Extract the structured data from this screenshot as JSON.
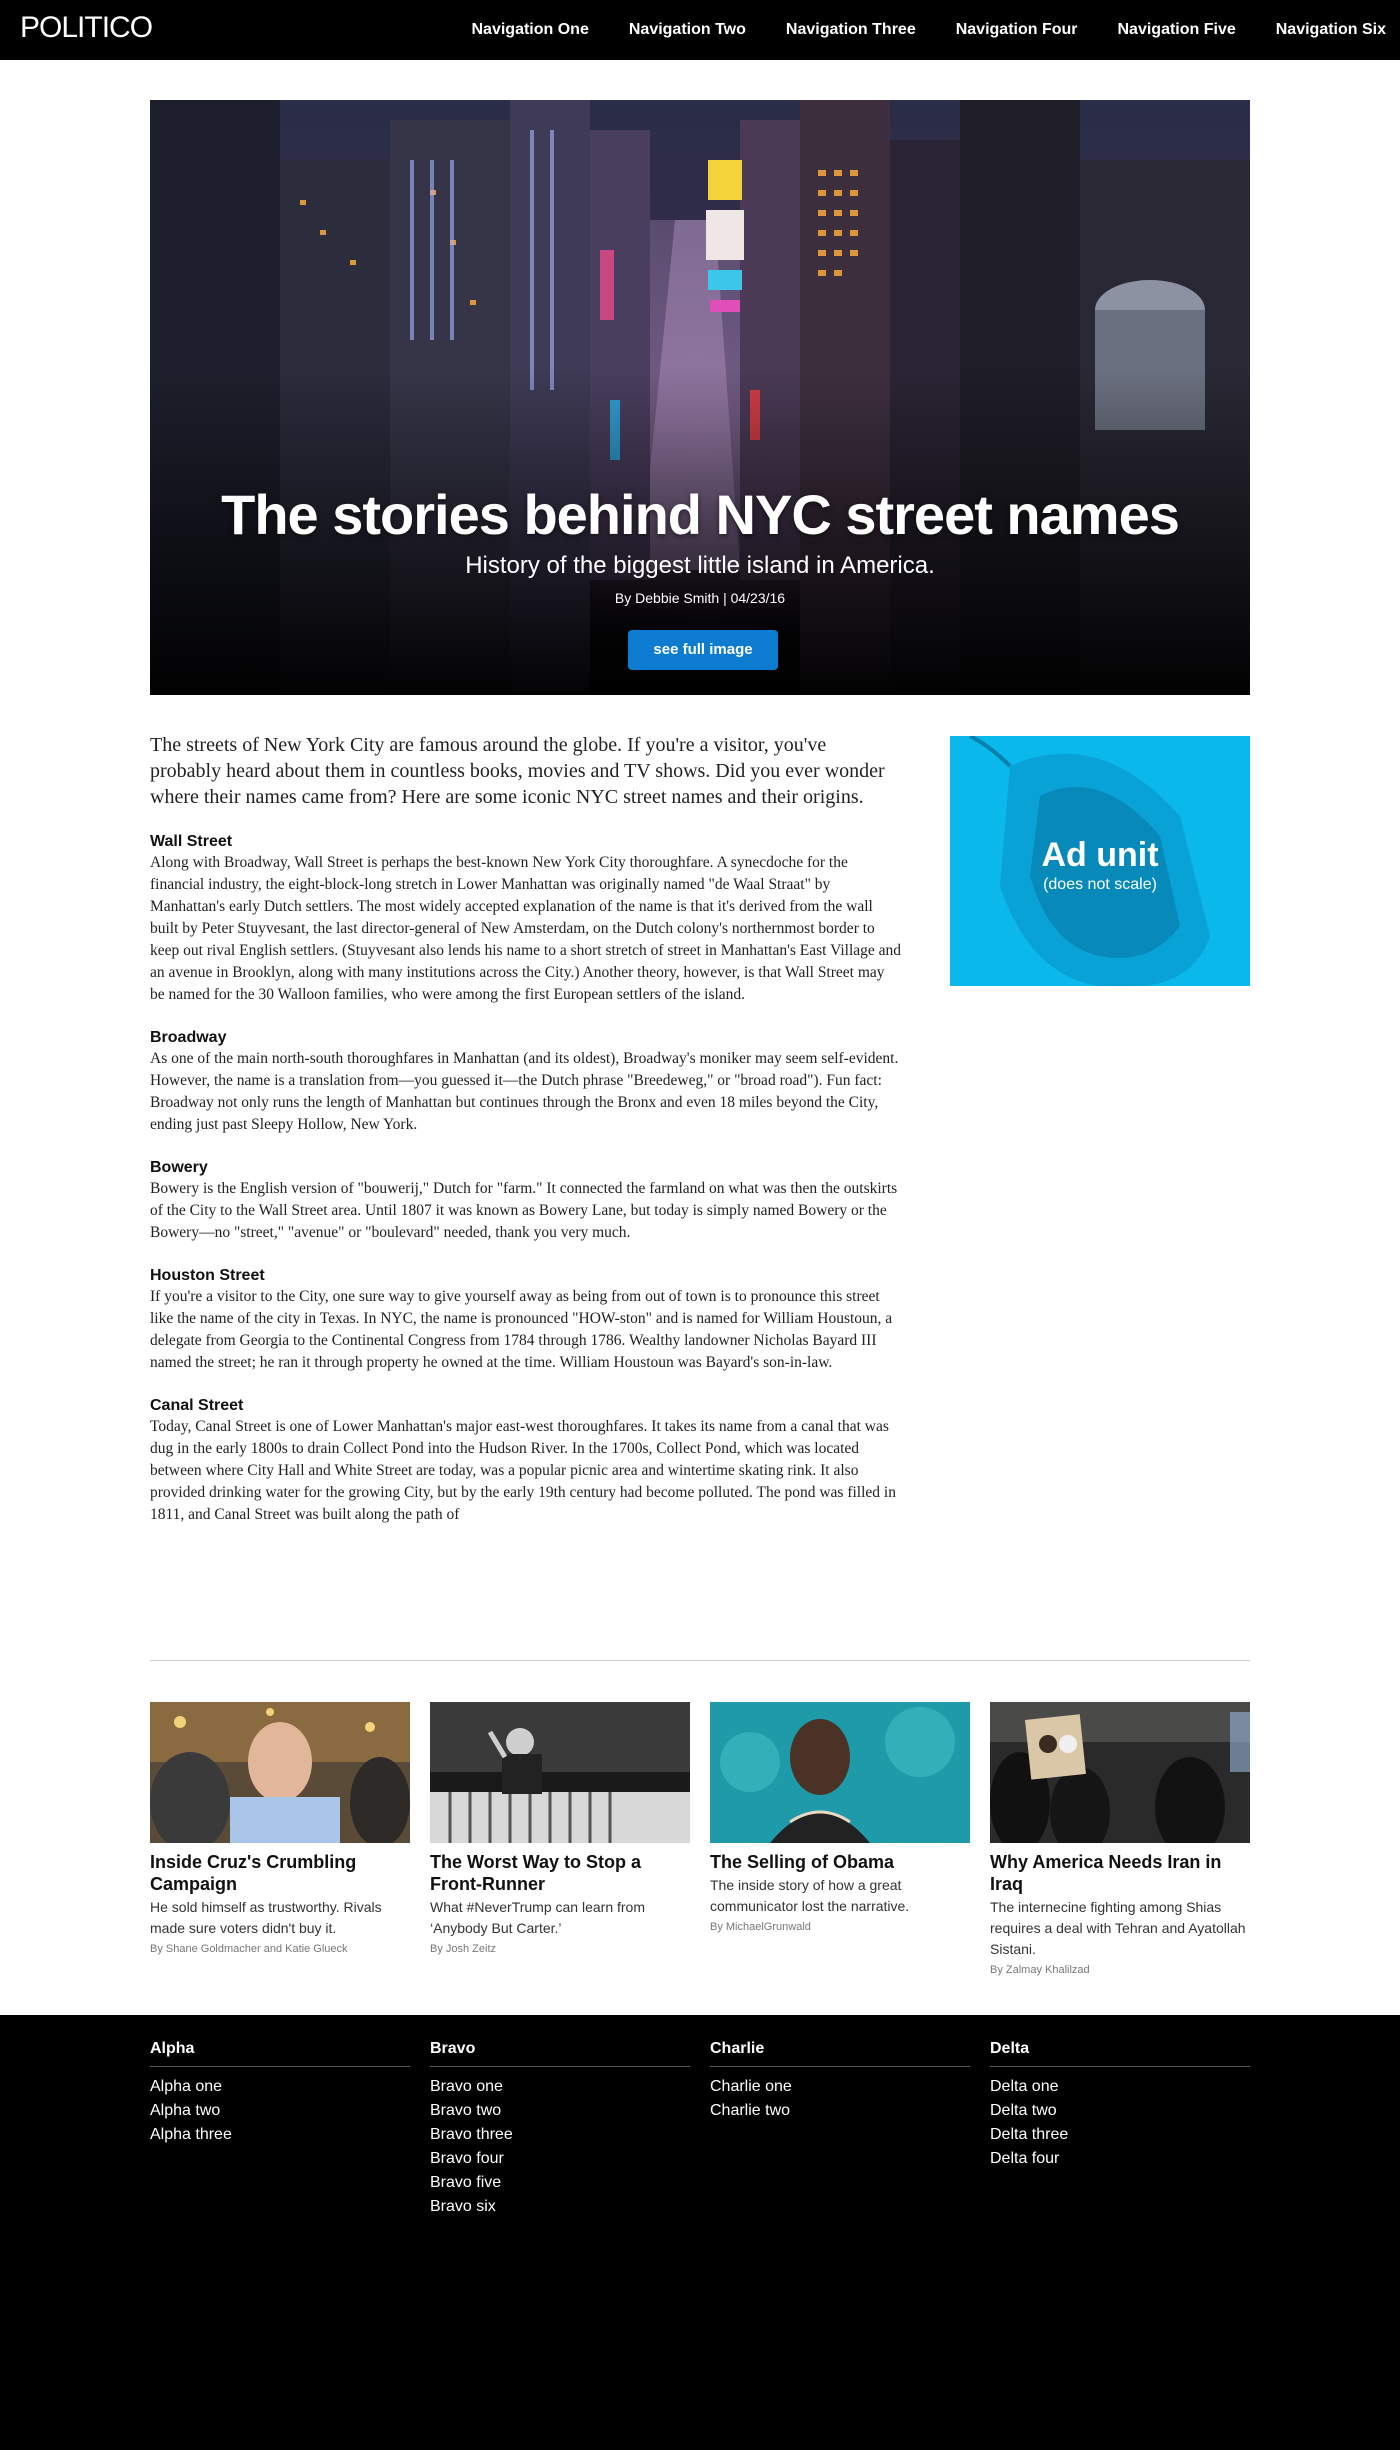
{
  "header": {
    "logo": "POLITICO",
    "nav": [
      "Navigation One",
      "Navigation Two",
      "Navigation Three",
      "Navigation Four",
      "Navigation Five",
      "Navigation Six"
    ]
  },
  "hero": {
    "title": "The stories behind NYC street names",
    "subtitle": "History of the biggest little island in America.",
    "byline": "By Debbie Smith | 04/23/16",
    "button": "see full image"
  },
  "article": {
    "lede": "The streets of New York City are famous around the globe. If you're a visitor, you've probably heard about them in countless books, movies and TV shows. Did you ever wonder where their names came from? Here are some iconic NYC street names and their origins.",
    "sections": [
      {
        "heading": "Wall Street",
        "body": "Along with Broadway, Wall Street is perhaps the best-known New York City thoroughfare. A synecdoche for the financial industry, the eight-block-long stretch in Lower Manhattan was originally named \"de Waal Straat\" by Manhattan's early Dutch settlers. The most widely accepted explanation of the name is that it's derived from the wall built by Peter Stuyvesant, the last director-general of New Amsterdam, on the Dutch colony's northernmost border to keep out rival English settlers. (Stuyvesant also lends his name to a short stretch of street in Manhattan's East Village and an avenue in Brooklyn, along with many institutions across the City.) Another theory, however, is that Wall Street may be named for the 30 Walloon families, who were among the first European settlers of the island."
      },
      {
        "heading": "Broadway",
        "body": "As one of the main north-south thoroughfares in Manhattan (and its oldest), Broadway's moniker may seem self-evident. However, the name is a translation from—you guessed it—the Dutch phrase \"Breedeweg,\" or \"broad road\"). Fun fact: Broadway not only runs the length of Manhattan but continues through the Bronx and even 18 miles beyond the City, ending just past Sleepy Hollow, New York."
      },
      {
        "heading": "Bowery",
        "body": "Bowery is the English version of \"bouwerij,\" Dutch for \"farm.\" It connected the farmland on what was then the outskirts of the City to the Wall Street area. Until 1807 it was known as Bowery Lane, but today is simply named Bowery or the Bowery—no \"street,\" \"avenue\" or \"boulevard\" needed, thank you very much."
      },
      {
        "heading": "Houston Street",
        "body": "If you're a visitor to the City, one sure way to give yourself away as being from out of town is to pronounce this street like the name of the city in Texas. In NYC, the name is pronounced \"HOW-ston\" and is named for William Houstoun, a delegate from Georgia to the Continental Congress from 1784 through 1786. Wealthy landowner Nicholas Bayard III named the street; he ran it through property he owned at the time. William Houstoun was Bayard's son-in-law."
      },
      {
        "heading": "Canal Street",
        "body": "Today, Canal Street is one of Lower Manhattan's major east-west thoroughfares. It takes its name from a canal that was dug in the early 1800s to drain Collect Pond into the Hudson River. In the 1700s, Collect Pond, which was located between where City Hall and White Street are today, was a popular picnic area and wintertime skating rink. It also provided drinking water for the growing City, but by the early 19th century had become polluted. The pond was filled in 1811, and Canal Street was built along the path of"
      }
    ]
  },
  "ad": {
    "title": "Ad unit",
    "subtitle": "(does not scale)",
    "color": "#0ab8ec"
  },
  "cards": [
    {
      "title": "Inside Cruz's Crumbling Campaign",
      "dek": "He sold himself as trustworthy. Rivals made sure voters didn't buy it.",
      "byline": "By Shane Goldmacher and Katie Glueck"
    },
    {
      "title": "The Worst Way to Stop a Front-Runner",
      "dek": "What #NeverTrump can learn from ‘Anybody But Carter.’",
      "byline": "By Josh Zeitz"
    },
    {
      "title": "The Selling of Obama",
      "dek": "The inside story of how a great communicator lost the narrative.",
      "byline": "By MichaelGrunwald"
    },
    {
      "title": "Why America Needs Iran in Iraq",
      "dek": "The internecine fighting among Shias requires a deal with Tehran and Ayatollah Sistani.",
      "byline": "By Zalmay Khalilzad"
    }
  ],
  "footer": {
    "columns": [
      {
        "heading": "Alpha",
        "links": [
          "Alpha one",
          "Alpha two",
          "Alpha three"
        ]
      },
      {
        "heading": "Bravo",
        "links": [
          "Bravo one",
          "Bravo two",
          "Bravo three",
          "Bravo four",
          "Bravo five",
          "Bravo six"
        ]
      },
      {
        "heading": "Charlie",
        "links": [
          "Charlie one",
          "Charlie two"
        ]
      },
      {
        "heading": "Delta",
        "links": [
          "Delta one",
          "Delta two",
          "Delta three",
          "Delta four"
        ]
      }
    ]
  }
}
